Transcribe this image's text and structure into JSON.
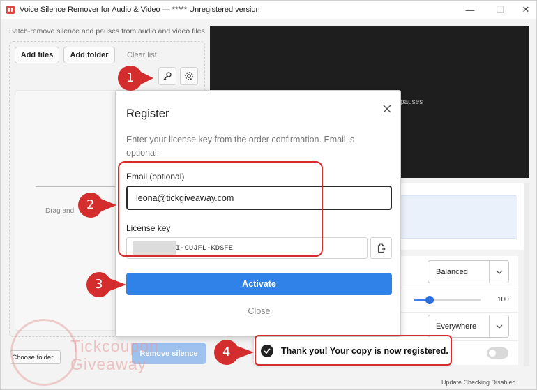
{
  "window": {
    "title": "Voice Silence Remover for Audio & Video — ***** Unregistered version",
    "minimize_glyph": "—",
    "maximize_glyph": "☐",
    "close_glyph": "✕"
  },
  "left_panel": {
    "subtitle": "Batch-remove silence and pauses from audio and video files.",
    "add_files": "Add files",
    "add_folder": "Add folder",
    "clear_list": "Clear list",
    "drag_text": "Drag and",
    "choose_folder": "Choose folder...",
    "remove_silence": "Remove silence"
  },
  "preview": {
    "text": "pauses"
  },
  "settings": {
    "mode_value": "Balanced",
    "slider_value": "100",
    "slider_level": 0.24,
    "position_value": "Everywhere",
    "toggle_on": false
  },
  "status_bar": {
    "text": "Update Checking Disabled"
  },
  "dialog": {
    "title": "Register",
    "description": "Enter your license key from the order confirmation. Email is optional.",
    "email_label": "Email (optional)",
    "email_value": "leona@tickgiveaway.com",
    "license_label": "License key",
    "license_visible_suffix": "I-CUJFL-KDSFE",
    "activate_label": "Activate",
    "close_label": "Close"
  },
  "toast": {
    "text": "Thank you! Your copy is now registered."
  },
  "annotations": {
    "markers": [
      "1",
      "2",
      "3",
      "4"
    ],
    "color": "#d42d2d"
  },
  "watermark": {
    "line1": "Tickcoupon",
    "line2": "Giveaway"
  },
  "colors": {
    "accent": "#3182e8",
    "preview_bg": "#1e1e1e",
    "annotation_red": "#d42d2d"
  }
}
